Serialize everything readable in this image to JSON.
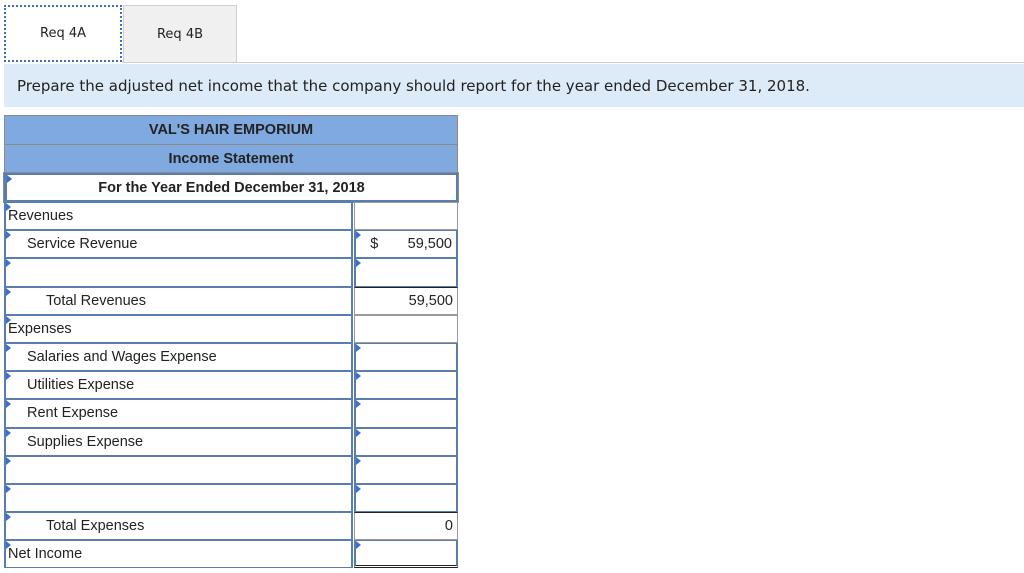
{
  "tabs": [
    {
      "label": "Req 4A",
      "active": true
    },
    {
      "label": "Req 4B",
      "active": false
    }
  ],
  "instruction": "Prepare the adjusted net income that the company should report for the year ended December 31, 2018.",
  "statement": {
    "company": "VAL'S HAIR EMPORIUM",
    "title": "Income Statement",
    "period": "For the Year Ended December 31, 2018",
    "rows": [
      {
        "label": "Revenues",
        "currency": "",
        "value": ""
      },
      {
        "label": "Service Revenue",
        "currency": "$",
        "value": "59,500"
      },
      {
        "label": "",
        "currency": "",
        "value": ""
      },
      {
        "label": "Total Revenues",
        "currency": "",
        "value": "59,500"
      },
      {
        "label": "Expenses",
        "currency": "",
        "value": ""
      },
      {
        "label": "Salaries and Wages Expense",
        "currency": "",
        "value": ""
      },
      {
        "label": "Utilities Expense",
        "currency": "",
        "value": ""
      },
      {
        "label": "Rent Expense",
        "currency": "",
        "value": ""
      },
      {
        "label": "Supplies Expense",
        "currency": "",
        "value": ""
      },
      {
        "label": "",
        "currency": "",
        "value": ""
      },
      {
        "label": "",
        "currency": "",
        "value": ""
      },
      {
        "label": "Total Expenses",
        "currency": "",
        "value": "0"
      },
      {
        "label": "Net Income",
        "currency": "",
        "value": ""
      }
    ]
  }
}
